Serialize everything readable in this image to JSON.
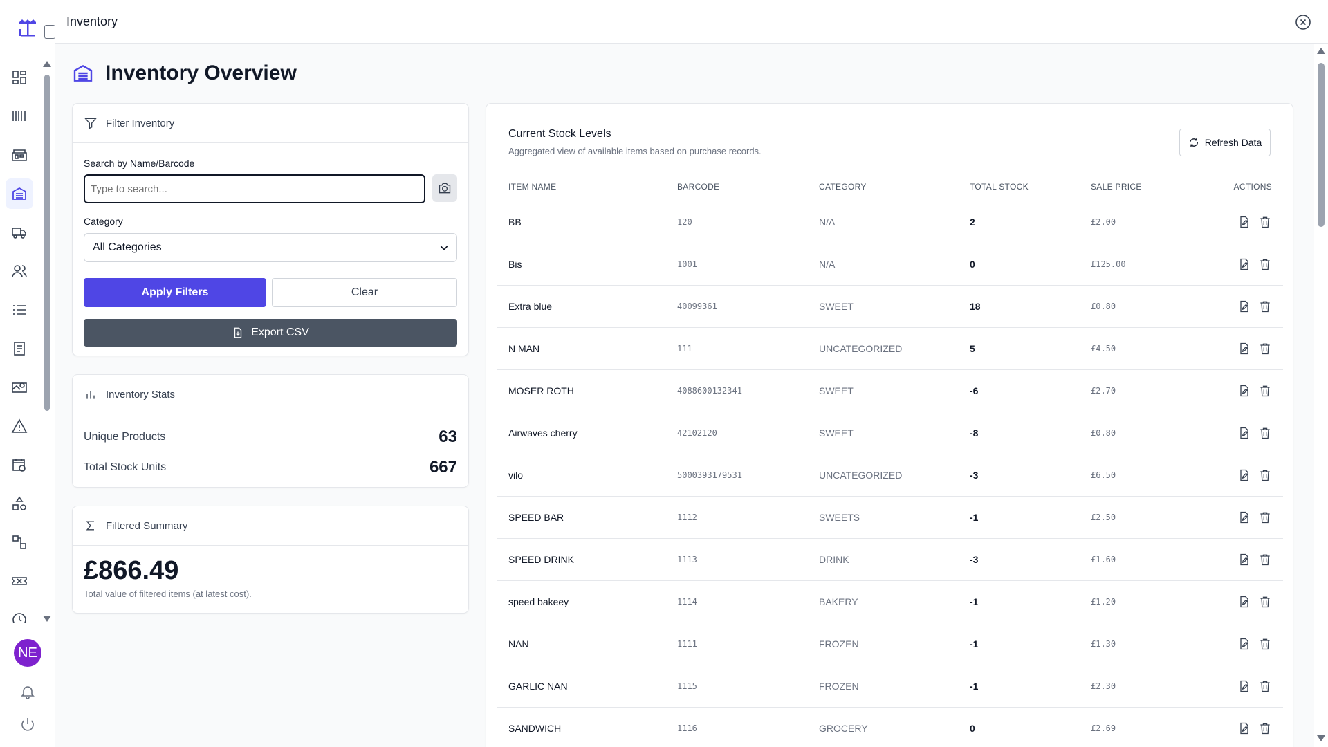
{
  "app": {
    "window_title": "Inventory",
    "avatar_initials": "NE"
  },
  "colors": {
    "accent": "#4f46e5",
    "dark_button": "#4b5563",
    "avatar": "#7e22ce"
  },
  "sidebar": {
    "items": [
      {
        "icon": "dashboard-icon"
      },
      {
        "icon": "barcode-icon"
      },
      {
        "icon": "store-icon"
      },
      {
        "icon": "warehouse-icon",
        "active": true
      },
      {
        "icon": "truck-icon"
      },
      {
        "icon": "users-icon"
      },
      {
        "icon": "list-icon"
      },
      {
        "icon": "document-icon"
      },
      {
        "icon": "map-icon"
      },
      {
        "icon": "warning-icon"
      },
      {
        "icon": "calendar-clock-icon"
      },
      {
        "icon": "shapes-icon"
      },
      {
        "icon": "workflow-icon"
      },
      {
        "icon": "ticket-icon"
      },
      {
        "icon": "clock-icon"
      }
    ]
  },
  "page": {
    "title": "Inventory Overview"
  },
  "filter": {
    "title": "Filter Inventory",
    "search_label": "Search by Name/Barcode",
    "search_placeholder": "Type to search...",
    "category_label": "Category",
    "category_selected": "All Categories",
    "apply_label": "Apply Filters",
    "clear_label": "Clear",
    "export_label": "Export CSV"
  },
  "stats": {
    "title": "Inventory Stats",
    "unique_label": "Unique Products",
    "unique_value": "63",
    "total_label": "Total Stock Units",
    "total_value": "667"
  },
  "summary": {
    "title": "Filtered Summary",
    "value": "£866.49",
    "caption": "Total value of filtered items (at latest cost)."
  },
  "stock": {
    "title": "Current Stock Levels",
    "subtitle": "Aggregated view of available items based on purchase records.",
    "refresh_label": "Refresh Data",
    "columns": [
      "ITEM NAME",
      "BARCODE",
      "CATEGORY",
      "TOTAL STOCK",
      "SALE PRICE",
      "ACTIONS"
    ],
    "rows": [
      {
        "name": "BB",
        "barcode": "120",
        "category": "N/A",
        "stock": "2",
        "price": "£2.00"
      },
      {
        "name": "Bis",
        "barcode": "1001",
        "category": "N/A",
        "stock": "0",
        "price": "£125.00"
      },
      {
        "name": "Extra blue",
        "barcode": "40099361",
        "category": "SWEET",
        "stock": "18",
        "price": "£0.80"
      },
      {
        "name": "N MAN",
        "barcode": "111",
        "category": "UNCATEGORIZED",
        "stock": "5",
        "price": "£4.50"
      },
      {
        "name": "MOSER ROTH",
        "barcode": "4088600132341",
        "category": "SWEET",
        "stock": "-6",
        "price": "£2.70"
      },
      {
        "name": "Airwaves cherry",
        "barcode": "42102120",
        "category": "SWEET",
        "stock": "-8",
        "price": "£0.80"
      },
      {
        "name": "vilo",
        "barcode": "5000393179531",
        "category": "UNCATEGORIZED",
        "stock": "-3",
        "price": "£6.50"
      },
      {
        "name": "SPEED BAR",
        "barcode": "1112",
        "category": "SWEETS",
        "stock": "-1",
        "price": "£2.50"
      },
      {
        "name": "SPEED DRINK",
        "barcode": "1113",
        "category": "DRINK",
        "stock": "-3",
        "price": "£1.60"
      },
      {
        "name": "speed bakeey",
        "barcode": "1114",
        "category": "BAKERY",
        "stock": "-1",
        "price": "£1.20"
      },
      {
        "name": "NAN",
        "barcode": "1111",
        "category": "FROZEN",
        "stock": "-1",
        "price": "£1.30"
      },
      {
        "name": "GARLIC NAN",
        "barcode": "1115",
        "category": "FROZEN",
        "stock": "-1",
        "price": "£2.30"
      },
      {
        "name": "SANDWICH",
        "barcode": "1116",
        "category": "GROCERY",
        "stock": "0",
        "price": "£2.69"
      }
    ]
  }
}
